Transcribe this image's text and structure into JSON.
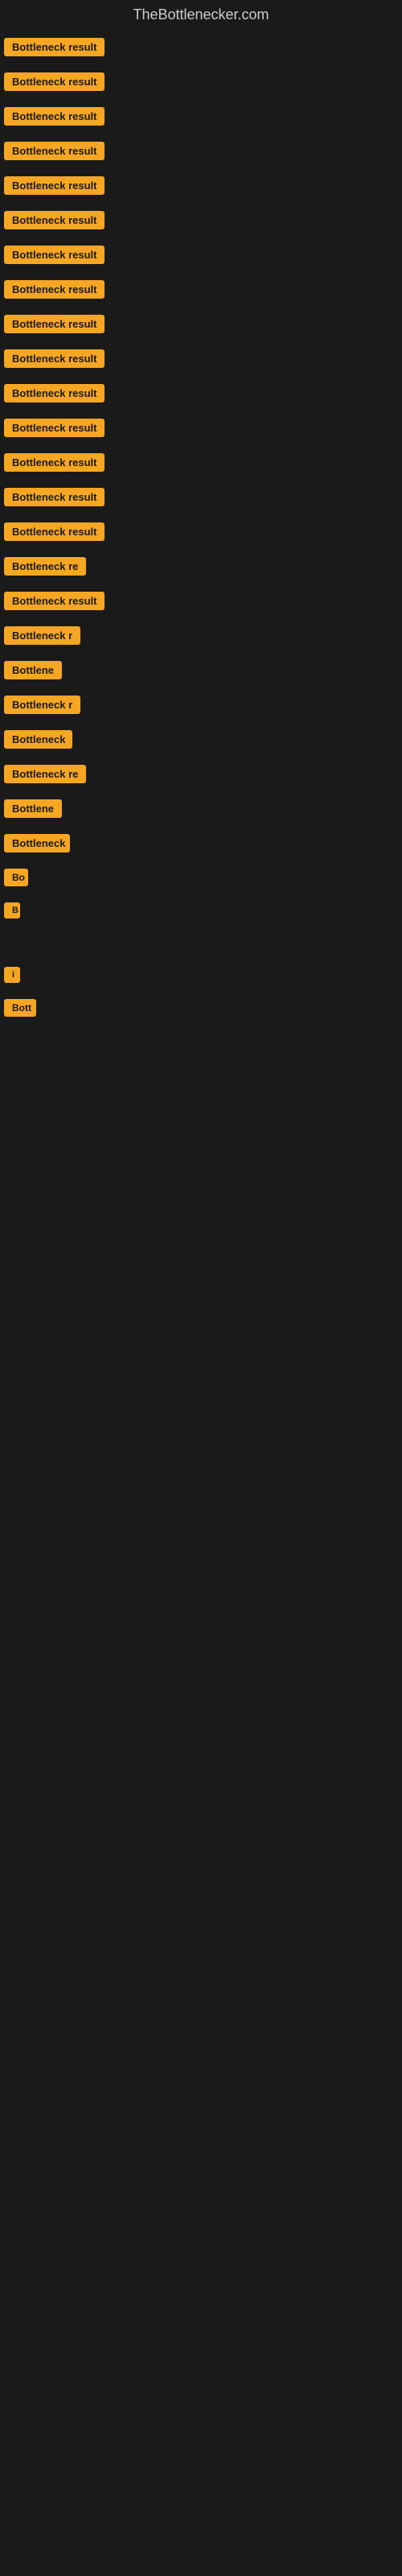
{
  "site": {
    "title": "TheBottlenecker.com"
  },
  "items": [
    {
      "label": "Bottleneck result",
      "width": 140
    },
    {
      "label": "Bottleneck result",
      "width": 140
    },
    {
      "label": "Bottleneck result",
      "width": 140
    },
    {
      "label": "Bottleneck result",
      "width": 140
    },
    {
      "label": "Bottleneck result",
      "width": 140
    },
    {
      "label": "Bottleneck result",
      "width": 140
    },
    {
      "label": "Bottleneck result",
      "width": 140
    },
    {
      "label": "Bottleneck result",
      "width": 140
    },
    {
      "label": "Bottleneck result",
      "width": 140
    },
    {
      "label": "Bottleneck result",
      "width": 140
    },
    {
      "label": "Bottleneck result",
      "width": 140
    },
    {
      "label": "Bottleneck result",
      "width": 140
    },
    {
      "label": "Bottleneck result",
      "width": 140
    },
    {
      "label": "Bottleneck result",
      "width": 140
    },
    {
      "label": "Bottleneck result",
      "width": 140
    },
    {
      "label": "Bottleneck re",
      "width": 105
    },
    {
      "label": "Bottleneck result",
      "width": 130
    },
    {
      "label": "Bottleneck r",
      "width": 95
    },
    {
      "label": "Bottlene",
      "width": 75
    },
    {
      "label": "Bottleneck r",
      "width": 95
    },
    {
      "label": "Bottleneck",
      "width": 85
    },
    {
      "label": "Bottleneck re",
      "width": 105
    },
    {
      "label": "Bottlene",
      "width": 75
    },
    {
      "label": "Bottleneck",
      "width": 82
    },
    {
      "label": "Bo",
      "width": 30
    },
    {
      "label": "B",
      "width": 18
    },
    {
      "label": "",
      "width": 0
    },
    {
      "label": "",
      "width": 0
    },
    {
      "label": "i",
      "width": 12
    },
    {
      "label": "Bott",
      "width": 40
    },
    {
      "label": "",
      "width": 0
    },
    {
      "label": "",
      "width": 0
    },
    {
      "label": "",
      "width": 0
    },
    {
      "label": "",
      "width": 0
    },
    {
      "label": "",
      "width": 0
    }
  ],
  "colors": {
    "badge_bg": "#f5a623",
    "badge_text": "#1a1a1a",
    "page_bg": "#1a1a1a",
    "title_text": "#cccccc"
  }
}
